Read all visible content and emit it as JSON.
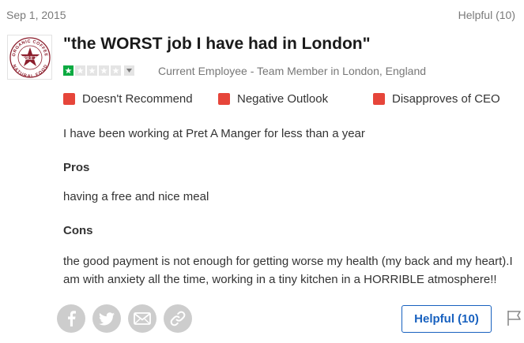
{
  "review": {
    "date": "Sep 1, 2015",
    "helpful_count_text": "Helpful (10)",
    "title": "\"the WORST job I have had in London\"",
    "rating": 1,
    "rating_max": 5,
    "author_meta": "Current Employee - Team Member in London, England",
    "flags": [
      {
        "label": "Doesn't Recommend",
        "color": "#e6453a"
      },
      {
        "label": "Negative Outlook",
        "color": "#e6453a"
      },
      {
        "label": "Disapproves of CEO",
        "color": "#e6453a"
      }
    ],
    "intro": "I have been working at Pret A Manger for less than a year",
    "pros_heading": "Pros",
    "pros_text": "having a free and nice meal",
    "cons_heading": "Cons",
    "cons_text": "the good payment is not enough for getting worse my health (my back and my heart).I am with anxiety all the time, working in a tiny kitchen in a HORRIBLE atmosphere!!"
  },
  "company_logo": {
    "ring_text_top": "ORGANIC COFFEE",
    "ring_text_bottom": "NATURAL FOOD",
    "center_text": "PRET",
    "color": "#8b1d2c"
  },
  "actions": {
    "share_icons": [
      "facebook-icon",
      "twitter-icon",
      "email-icon",
      "link-icon"
    ],
    "helpful_button_label": "Helpful (10)",
    "report_icon": "flag-icon"
  },
  "colors": {
    "star_filled": "#0caa41",
    "star_empty": "#e4e4e4",
    "accent_blue": "#1861bf"
  }
}
